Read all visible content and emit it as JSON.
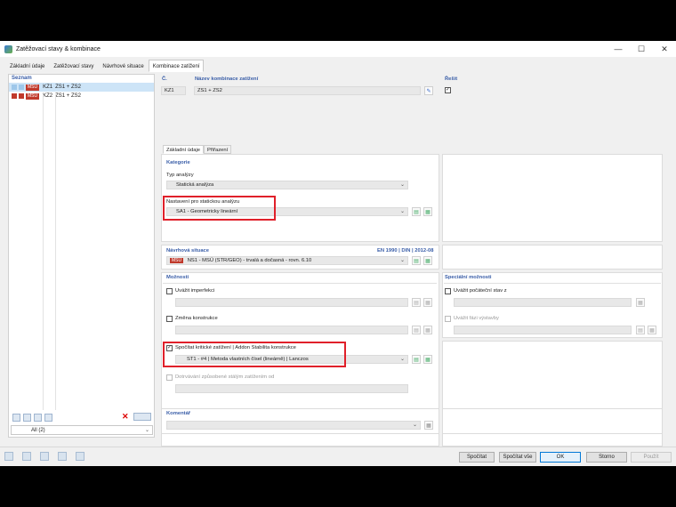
{
  "window": {
    "title": "Zatěžovací stavy & kombinace",
    "controls": [
      "—",
      "☐",
      "✕"
    ]
  },
  "tabs": [
    "Základní údaje",
    "Zatěžovací stavy",
    "Návrhové situace",
    "Kombinace zatížení"
  ],
  "left": {
    "header": "Seznam",
    "items": [
      {
        "tag": "MSÚ",
        "id": "KZ1",
        "name": "ZS1 + ZS2"
      },
      {
        "tag": "MSÚ",
        "id": "KZ2",
        "name": "ZS1 + ZS2"
      }
    ],
    "filter": "All (2)"
  },
  "top": {
    "no_label": "Č.",
    "no_value": "KZ1",
    "name_label": "Název kombinace zatížení",
    "name_value": "ZS1 + ZS2",
    "solve_label": "Řešit"
  },
  "subtabs": [
    "Základní údaje",
    "Přiřazení"
  ],
  "kategorie": {
    "header": "Kategorie",
    "typ_label": "Typ analýzy",
    "typ_value": "Statická analýza",
    "nast_label": "Nastavení pro statickou analýzu",
    "nast_value": "SA1 - Geometricky lineární"
  },
  "situace": {
    "header": "Návrhová situace",
    "norm": "EN 1990 | DIN | 2012-08",
    "tag": "MSÚ",
    "value": "NS1 - MSÚ (STR/GEO) - trvalá a dočasná - rovn. 6.10"
  },
  "moznosti": {
    "header": "Možnosti",
    "imperf": "Uvážit imperfekci",
    "zmena": "Změna konstrukce",
    "krit": "Spočítat kritické zatížení | Addon Stabilita konstrukce",
    "krit_value": "ST1 - #4 | Metoda vlastních čísel (lineárně) | Lanczos",
    "dotr": "Dotrvávání způsobené stálým zatížením od"
  },
  "special": {
    "header": "Speciální možnosti",
    "poc": "Uvážit počáteční stav z",
    "faze": "Uvážit fázi výstavby"
  },
  "komentar": {
    "header": "Komentář"
  },
  "buttons": {
    "spocitat": "Spočítat",
    "spocitat_vse": "Spočítat vše",
    "ok": "OK",
    "storno": "Storno",
    "pouzit": "Použít"
  }
}
